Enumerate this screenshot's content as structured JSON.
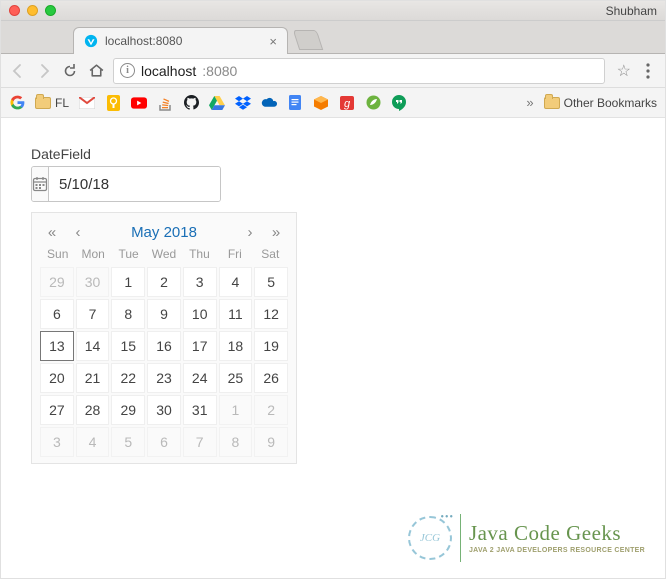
{
  "titlebar": {
    "profile": "Shubham"
  },
  "tab": {
    "title": "localhost:8080",
    "close": "×"
  },
  "addr": {
    "host": "localhost",
    "port": ":8080"
  },
  "bookmarks": {
    "fl": "FL",
    "other": "Other Bookmarks",
    "chev": "»"
  },
  "field": {
    "label": "DateField",
    "value": "5/10/18"
  },
  "picker": {
    "nav": {
      "dprev": "«",
      "prev": "‹",
      "next": "›",
      "dnext": "»"
    },
    "month": "May 2018",
    "dow": [
      "Sun",
      "Mon",
      "Tue",
      "Wed",
      "Thu",
      "Fri",
      "Sat"
    ],
    "cells": [
      {
        "d": "29",
        "out": true
      },
      {
        "d": "30",
        "out": true
      },
      {
        "d": "1"
      },
      {
        "d": "2"
      },
      {
        "d": "3"
      },
      {
        "d": "4"
      },
      {
        "d": "5"
      },
      {
        "d": "6"
      },
      {
        "d": "7"
      },
      {
        "d": "8"
      },
      {
        "d": "9"
      },
      {
        "d": "10"
      },
      {
        "d": "11"
      },
      {
        "d": "12"
      },
      {
        "d": "13",
        "sel": true
      },
      {
        "d": "14"
      },
      {
        "d": "15"
      },
      {
        "d": "16"
      },
      {
        "d": "17"
      },
      {
        "d": "18"
      },
      {
        "d": "19"
      },
      {
        "d": "20"
      },
      {
        "d": "21"
      },
      {
        "d": "22"
      },
      {
        "d": "23"
      },
      {
        "d": "24"
      },
      {
        "d": "25"
      },
      {
        "d": "26"
      },
      {
        "d": "27"
      },
      {
        "d": "28"
      },
      {
        "d": "29"
      },
      {
        "d": "30"
      },
      {
        "d": "31"
      },
      {
        "d": "1",
        "out": true
      },
      {
        "d": "2",
        "out": true
      },
      {
        "d": "3",
        "out": true
      },
      {
        "d": "4",
        "out": true
      },
      {
        "d": "5",
        "out": true
      },
      {
        "d": "6",
        "out": true
      },
      {
        "d": "7",
        "out": true
      },
      {
        "d": "8",
        "out": true
      },
      {
        "d": "9",
        "out": true
      }
    ]
  },
  "watermark": {
    "circle": "JCG",
    "main": "Java Code Geeks",
    "sub": "JAVA 2 JAVA DEVELOPERS RESOURCE CENTER"
  }
}
